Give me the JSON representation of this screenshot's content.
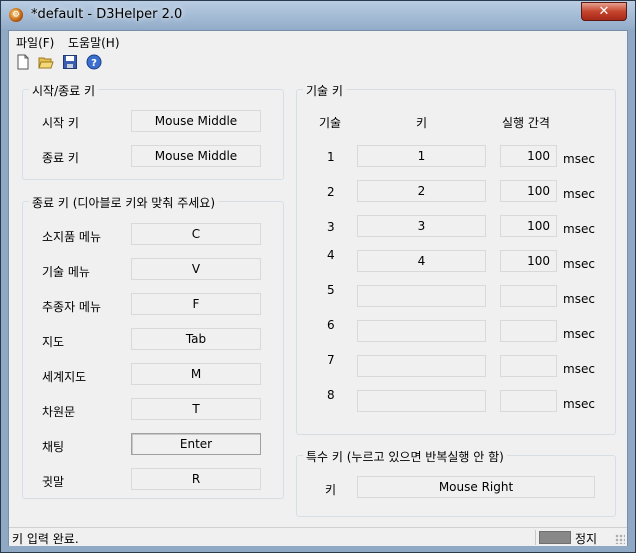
{
  "window": {
    "title": "*default - D3Helper 2.0",
    "close_glyph": "✕"
  },
  "menu": [
    "파일(F)",
    "도움말(H)"
  ],
  "toolbar": [
    "new-file-icon",
    "open-folder-icon",
    "save-icon",
    "help-icon"
  ],
  "start_stop": {
    "legend": "시작/종료 키",
    "rows": [
      {
        "label": "시작 키",
        "value": "Mouse Middle"
      },
      {
        "label": "종료 키",
        "value": "Mouse Middle"
      }
    ]
  },
  "game_keys": {
    "legend": "종료 키 (디아블로 키와 맞춰 주세요)",
    "rows": [
      {
        "label": "소지품 메뉴",
        "value": "C"
      },
      {
        "label": "기술 메뉴",
        "value": "V"
      },
      {
        "label": "추종자 메뉴",
        "value": "F"
      },
      {
        "label": "지도",
        "value": "Tab"
      },
      {
        "label": "세계지도",
        "value": "M"
      },
      {
        "label": "차원문",
        "value": "T"
      },
      {
        "label": "채팅",
        "value": "Enter"
      },
      {
        "label": "귓말",
        "value": "R"
      }
    ]
  },
  "skill_keys": {
    "legend": "기술 키",
    "col_skill": "기술",
    "col_key": "키",
    "col_interval": "실행 간격",
    "unit": "msec",
    "rows": [
      {
        "num": "1",
        "key": "1",
        "interval": "100"
      },
      {
        "num": "2",
        "key": "2",
        "interval": "100"
      },
      {
        "num": "3",
        "key": "3",
        "interval": "100"
      },
      {
        "num": "4",
        "key": "4",
        "interval": "100"
      },
      {
        "num": "5",
        "key": "",
        "interval": ""
      },
      {
        "num": "6",
        "key": "",
        "interval": ""
      },
      {
        "num": "7",
        "key": "",
        "interval": ""
      },
      {
        "num": "8",
        "key": "",
        "interval": ""
      }
    ]
  },
  "special": {
    "legend": "특수 키 (누르고 있으면 반복실행 안 함)",
    "label": "키",
    "value": "Mouse Right"
  },
  "status": {
    "message": "키 입력 완료.",
    "state": "정지",
    "indicator_color": "#888888"
  }
}
